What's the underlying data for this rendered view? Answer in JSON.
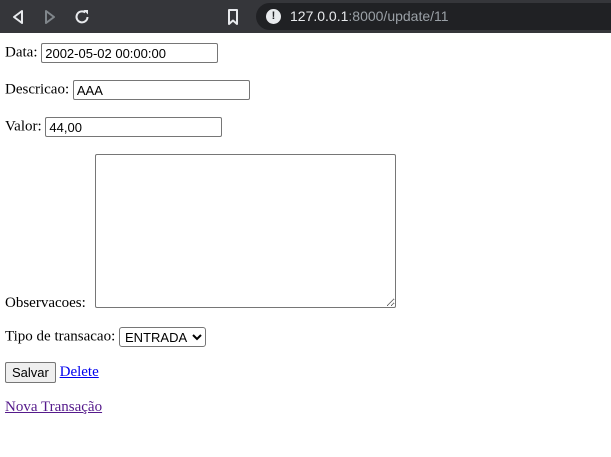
{
  "browser": {
    "url_host": "127.0.0.1",
    "url_rest": ":8000/update/11"
  },
  "form": {
    "data": {
      "label": "Data:",
      "value": "2002-05-02 00:00:00"
    },
    "descricao": {
      "label": "Descricao:",
      "value": "AAA"
    },
    "valor": {
      "label": "Valor:",
      "value": "44,00"
    },
    "observacoes": {
      "label": "Observacoes:",
      "value": ""
    },
    "tipo": {
      "label": "Tipo de transacao:",
      "selected": "ENTRADA"
    },
    "save_label": "Salvar",
    "delete_label": "Delete",
    "new_link": "Nova Transação"
  }
}
